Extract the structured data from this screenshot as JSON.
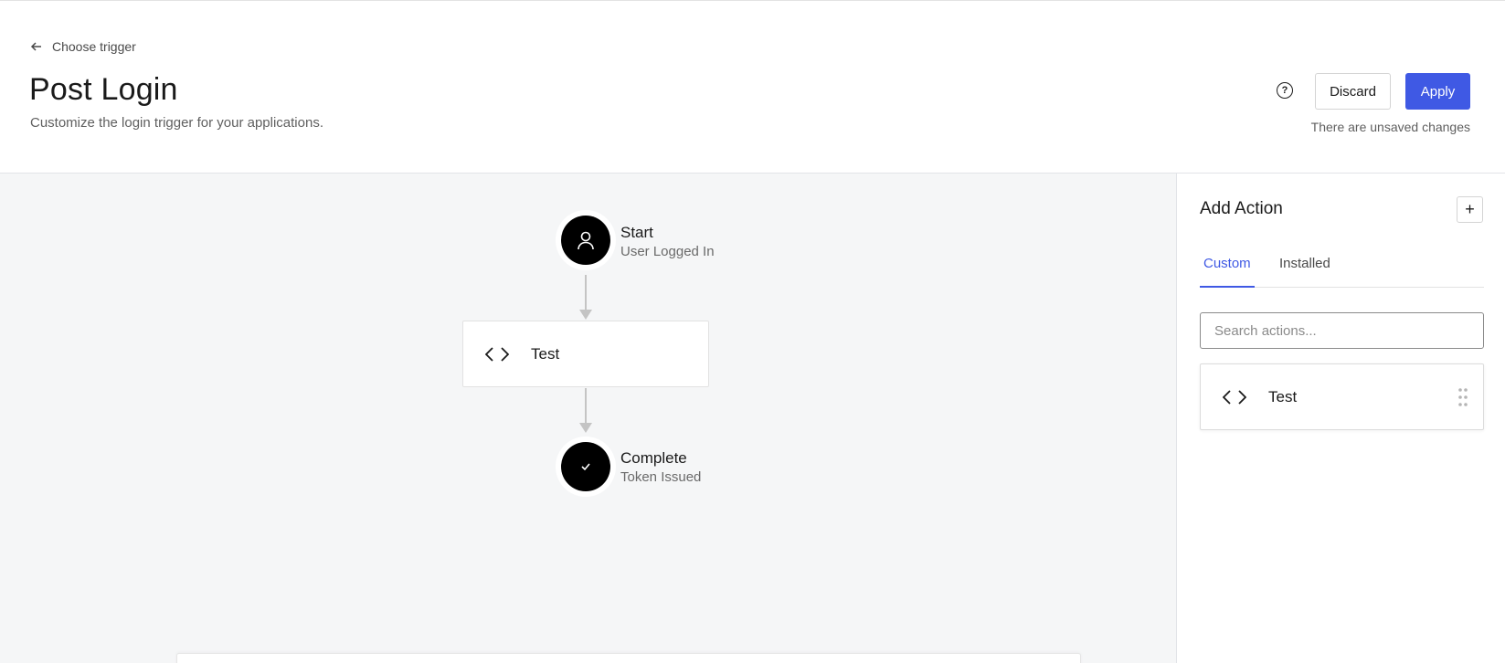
{
  "header": {
    "back_label": "Choose trigger",
    "title": "Post Login",
    "subtitle": "Customize the login trigger for your applications.",
    "help_icon": "question-circle-icon",
    "discard_label": "Discard",
    "apply_label": "Apply",
    "unsaved_text": "There are unsaved changes"
  },
  "flow": {
    "start": {
      "title": "Start",
      "subtitle": "User Logged In",
      "icon": "user-icon"
    },
    "action": {
      "label": "Test",
      "icon": "code-icon"
    },
    "end": {
      "title": "Complete",
      "subtitle": "Token Issued",
      "icon": "check-icon"
    }
  },
  "sidebar": {
    "title": "Add Action",
    "add_label": "+",
    "tabs": [
      {
        "label": "Custom",
        "active": true
      },
      {
        "label": "Installed",
        "active": false
      }
    ],
    "search_placeholder": "Search actions...",
    "actions": [
      {
        "label": "Test",
        "icon": "code-icon"
      }
    ]
  },
  "colors": {
    "accent": "#3f59e4",
    "canvas_bg": "#f5f6f7",
    "node": "#000000"
  }
}
